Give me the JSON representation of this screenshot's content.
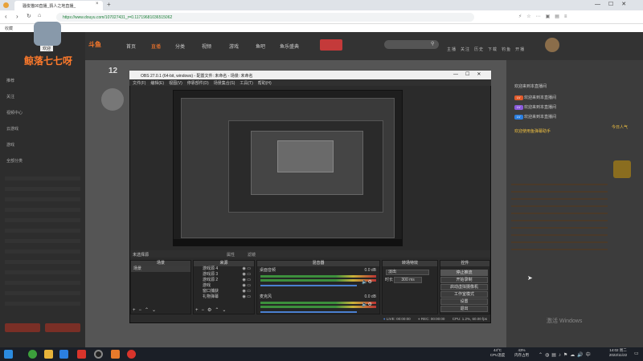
{
  "browser": {
    "tab_title": "骚俊猫90直播_猜人之地直播_",
    "url": "https://www.douyu.com/107027431_r=0.1171968103651506​2",
    "bookmark": "收藏"
  },
  "douyu": {
    "username": "鲸落七七呀",
    "user_badge": "欢迎",
    "nav": [
      "首页",
      "直播",
      "分类",
      "视频",
      "游戏",
      "鱼吧",
      "鱼乐盛典"
    ],
    "header_icons": [
      "主播",
      "关注",
      "历史",
      "下载",
      "钓鱼",
      "开播"
    ],
    "sidebar_rows": [
      "推荐",
      "关注",
      "视频中心",
      "云游戏",
      "游戏",
      "全部分类"
    ],
    "room_number": "12",
    "chat": [
      {
        "text": "欢迎来到本直播间",
        "badge": ""
      },
      {
        "text": "欢迎来到本直播间",
        "badge": "LV"
      },
      {
        "text": "欢迎来到本直播间",
        "badge": "LV"
      },
      {
        "text": "欢迎来到本直播间",
        "badge": "LV"
      },
      {
        "text": "欢迎使用鱼弹幕助手",
        "badge": ""
      }
    ],
    "rank_label": "今日人气",
    "watermark": "激活 Windows"
  },
  "obs": {
    "title": "OBS 27.0.1 (64-bit, windows) - 配置文件: 未命名 - 场景: 未命名",
    "menu": [
      "文件(F)",
      "编辑(E)",
      "视图(V)",
      "停靠部件(D)",
      "场景集合(S)",
      "工具(T)",
      "帮助(H)"
    ],
    "source_bar": "未选择源",
    "source_bar_buttons": [
      "属性",
      "滤镜"
    ],
    "docks": {
      "scenes": {
        "title": "场景",
        "items": [
          "场景"
        ]
      },
      "sources": {
        "title": "来源",
        "items": [
          "游戏源 4",
          "游戏源 3",
          "游戏源 2",
          "游戏",
          "窗口捕获",
          "礼物弹幕"
        ]
      },
      "mixer": {
        "title": "混音器",
        "channels": [
          {
            "name": "桌面音频",
            "db": "0.0 dB"
          },
          {
            "name": "麦克风",
            "db": "0.0 dB"
          }
        ]
      },
      "transitions": {
        "title": "转场特效",
        "type": "淡出",
        "duration_label": "时长",
        "duration": "300 ms"
      },
      "controls": {
        "title": "控件",
        "buttons": [
          "停止推流",
          "开始录制",
          "启动虚拟摄像机",
          "工作室模式",
          "设置",
          "退出"
        ]
      }
    },
    "status": {
      "live": "LIVE: 00:00:00",
      "rec": "REC: 00:00:00",
      "cpu": "CPU: 1.2%, 60.00 fps"
    }
  },
  "taskbar": {
    "temp": "44°C",
    "temp_label": "CPU温度",
    "mem": "43%",
    "mem_label": "内存占用",
    "time": "14:02 周二",
    "date": "2022/11/22"
  },
  "colors": {
    "accent": "#ff7a2b",
    "live_red": "#c43a3a",
    "obs_bg": "#2b2b2b"
  }
}
